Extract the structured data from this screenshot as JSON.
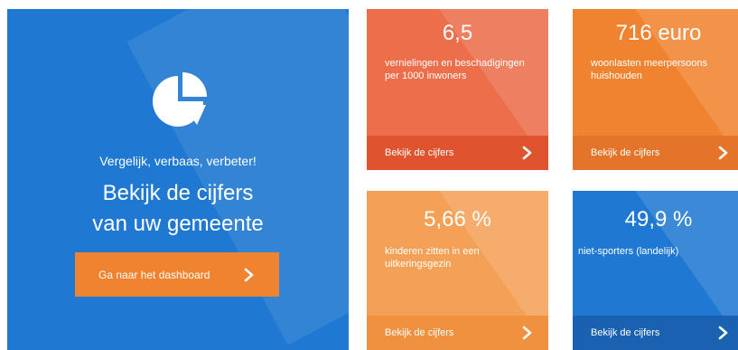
{
  "hero": {
    "icon": "pie-chart-icon",
    "tagline": "Vergelijk, verbaas, verbeter!",
    "title_line1": "Bekijk de cijfers",
    "title_line2": "van uw gemeente",
    "cta_label": "Ga naar het dashboard"
  },
  "tiles": [
    {
      "value": "6,5",
      "description": "vernielingen en beschadigingen per 1000 inwoners",
      "link_label": "Bekijk de cijfers",
      "color": "#ec6e4b"
    },
    {
      "value": "716 euro",
      "description": "woonlasten meerpersoons huishouden",
      "link_label": "Bekijk de cijfers",
      "color": "#f0832f"
    },
    {
      "value": "5,66 %",
      "description": "kinderen zitten in een uitkeringsgezin",
      "link_label": "Bekijk de cijfers",
      "color": "#f5a057"
    },
    {
      "value": "49,9 %",
      "description": "niet-sporters (landelijk)",
      "link_label": "Bekijk de cijfers",
      "color": "#1f78d1"
    }
  ],
  "colors": {
    "brand_blue": "#1f78d1",
    "brand_orange": "#f0832f"
  },
  "icons": {
    "tile_link": "chevron-right-icon",
    "cta": "chevron-right-icon"
  }
}
